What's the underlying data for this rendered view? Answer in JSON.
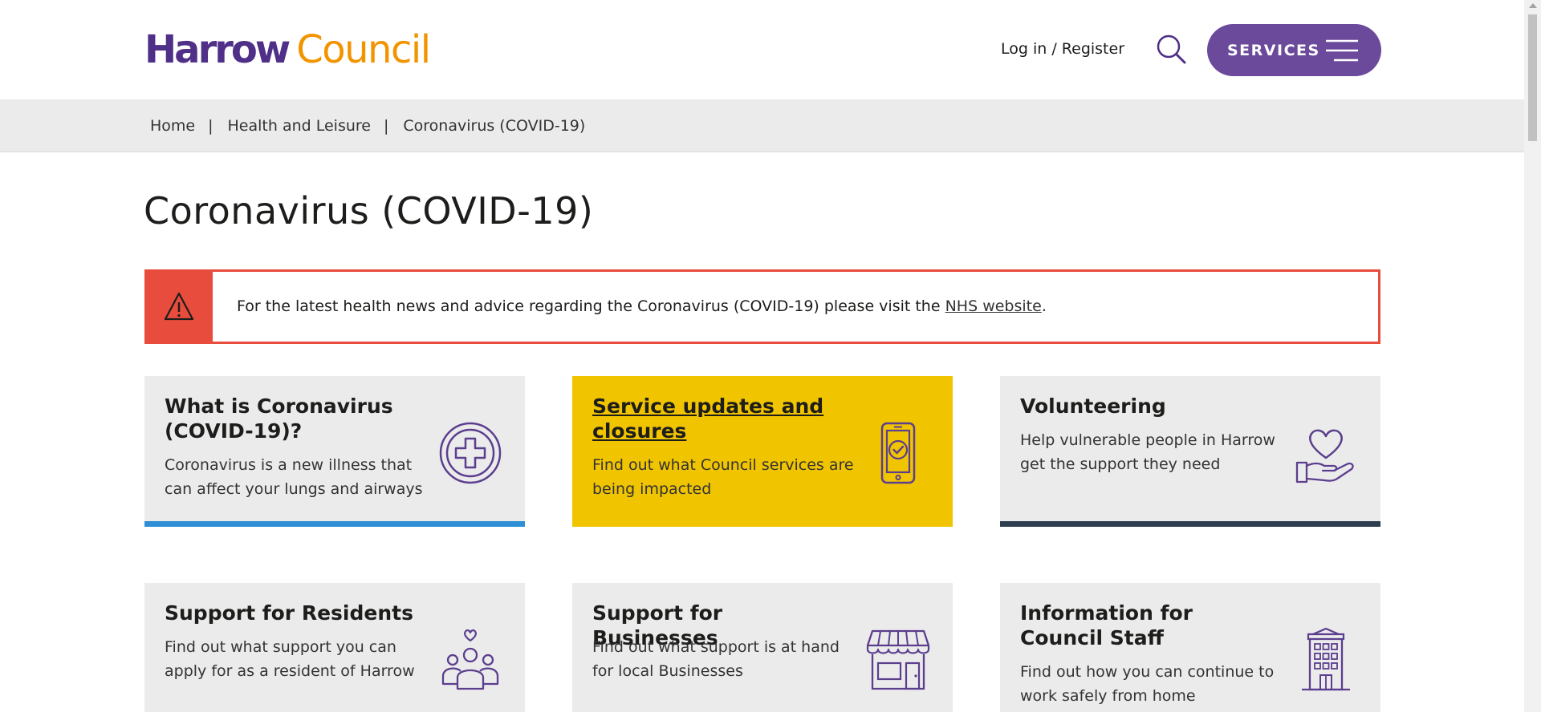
{
  "header": {
    "logo_harrow": "Harrow",
    "logo_council": "Council",
    "login_label": "Log in",
    "login_sep": " / ",
    "register_label": "Register",
    "services_label": "SERVICES"
  },
  "breadcrumb": {
    "items": [
      "Home",
      "Health and Leisure",
      "Coronavirus (COVID-19)"
    ],
    "separator": "|"
  },
  "page": {
    "title": "Coronavirus (COVID-19)"
  },
  "alert": {
    "text_before": "For the latest health news and advice regarding the Coronavirus (COVID-19) please visit the ",
    "link_text": "NHS website",
    "text_after": "."
  },
  "cards": [
    {
      "title": "What is Coronavirus (COVID-19)?",
      "description": "Coronavirus is a new illness that can affect your lungs and airways",
      "icon": "medical-cross-icon",
      "accent": "#2e8fd6"
    },
    {
      "title": "Service updates and closures",
      "description": "Find out what Council services are being impacted",
      "icon": "mobile-check-icon",
      "accent": "#f1c400"
    },
    {
      "title": "Volunteering",
      "description": "Help vulnerable people in Harrow get the support they need",
      "icon": "heart-hand-icon",
      "accent": "#2c3e50"
    },
    {
      "title": "Support for Residents",
      "description": "Find out what support you can apply for as a resident of Harrow",
      "icon": "people-heart-icon",
      "accent": ""
    },
    {
      "title": "Support for Businesses",
      "description": "Find out what support is at hand for local Businesses",
      "icon": "shop-icon",
      "accent": ""
    },
    {
      "title": "Information for Council Staff",
      "description": "Find out how you can continue to work safely from home",
      "icon": "office-building-icon",
      "accent": ""
    }
  ],
  "colors": {
    "brand_purple": "#4f2f87",
    "brand_orange": "#f29400",
    "services_button": "#6b4a9b",
    "alert_red": "#e74c3c",
    "icon_purple": "#5b3e8e",
    "highlight_yellow": "#f1c400"
  }
}
